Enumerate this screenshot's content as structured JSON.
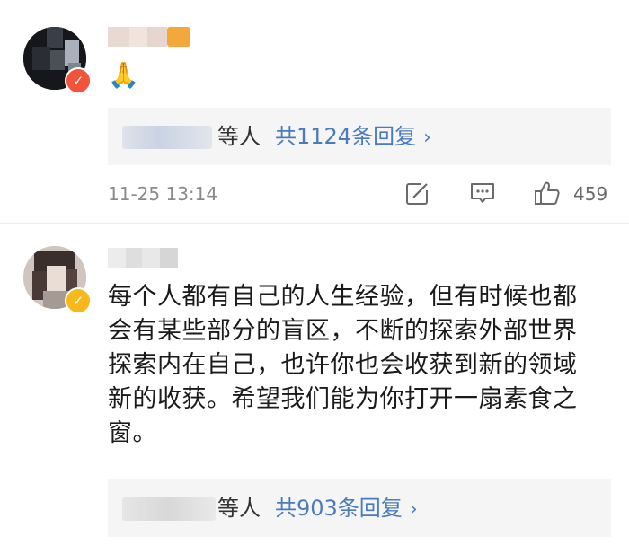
{
  "comments": [
    {
      "emoji": "🙏",
      "replies": {
        "etal_label": "等人",
        "count_label": "共1124条回复",
        "chevron": "›"
      },
      "timestamp": "11-25 13:14",
      "like_count": "459",
      "badge_icon": "check-icon",
      "badge_color": "#f3533a"
    },
    {
      "text_lines": [
        "每个人都有自己的人生经验，但有时候也都",
        "会有某些部分的盲区，不断的探索外部世界",
        "探索内在自己，也许你也会收获到新的领域",
        "新的收获。希望我们能为你打开一扇素食之",
        "窗。"
      ],
      "replies": {
        "etal_label": "等人",
        "count_label": "共903条回复",
        "chevron": "›"
      },
      "badge_icon": "check-icon",
      "badge_color": "#f6b81b"
    }
  ],
  "colors": {
    "link_blue": "#4a7bbd",
    "meta_gray": "#8a8a8a",
    "reply_bg": "#f5f5f5"
  }
}
